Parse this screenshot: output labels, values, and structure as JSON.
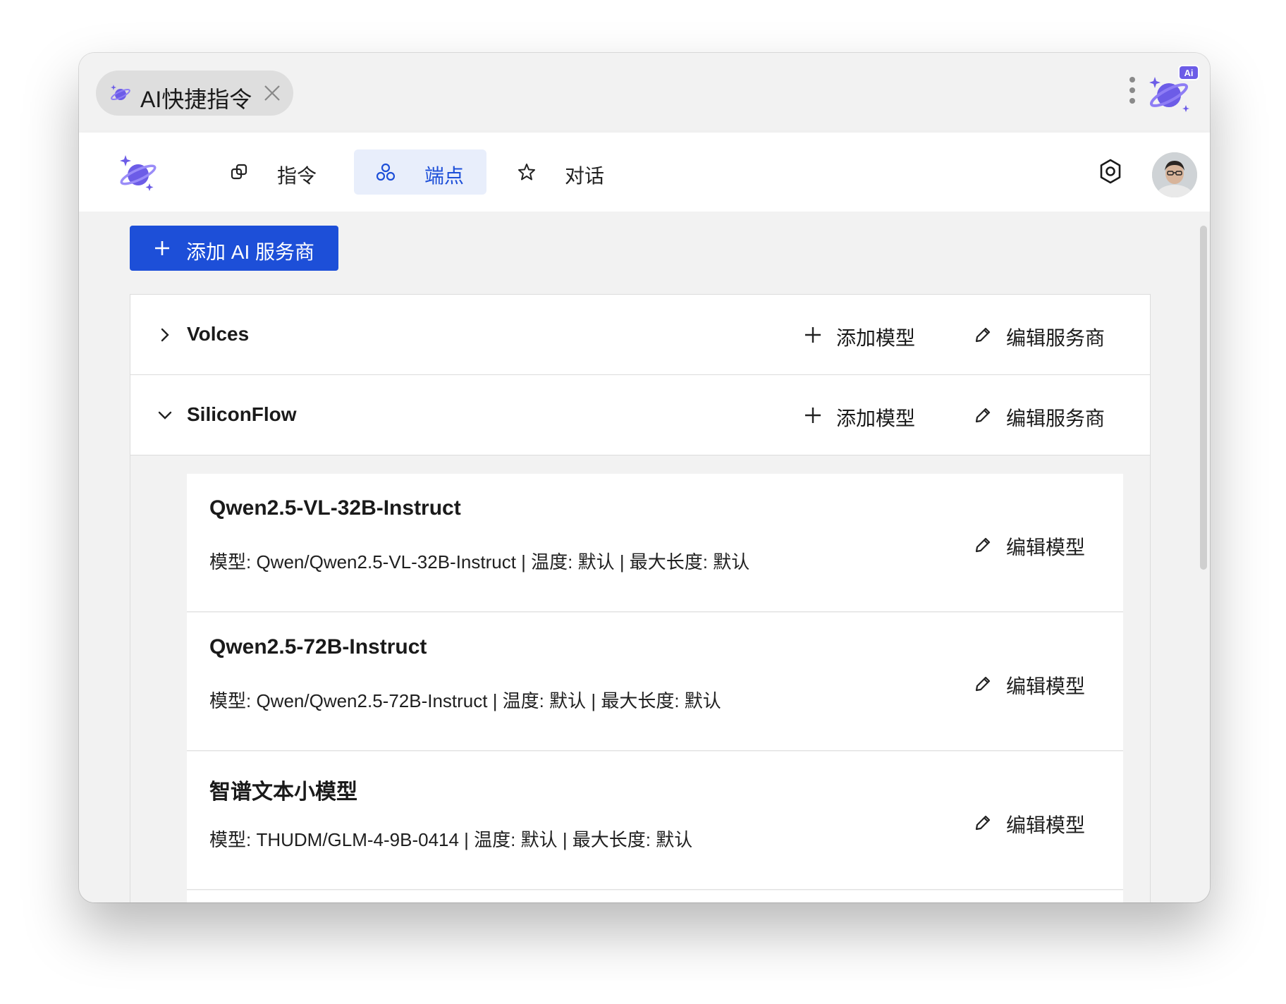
{
  "window": {
    "tab": {
      "title": "AI快捷指令",
      "logo_icon": "ai-planet-icon",
      "close_icon": "close-icon"
    },
    "menu_icon": "kebab-menu-icon",
    "corner_logo": {
      "icon": "ai-planet-icon",
      "badge": "Ai"
    }
  },
  "navbar": {
    "logo_icon": "planet-logo-icon",
    "items": [
      {
        "label": "指令",
        "icon": "command-icon",
        "active": false
      },
      {
        "label": "端点",
        "icon": "endpoints-icon",
        "active": true
      },
      {
        "label": "对话",
        "icon": "star-chat-icon",
        "active": false
      }
    ],
    "settings_icon": "settings-icon",
    "avatar": "user-avatar"
  },
  "toolbar": {
    "add_provider_label": "添加 AI 服务商"
  },
  "providers": [
    {
      "name": "Volces",
      "expanded": false,
      "add_model_label": "添加模型",
      "edit_provider_label": "编辑服务商"
    },
    {
      "name": "SiliconFlow",
      "expanded": true,
      "add_model_label": "添加模型",
      "edit_provider_label": "编辑服务商"
    }
  ],
  "models": [
    {
      "title": "Qwen2.5-VL-32B-Instruct",
      "description": "模型: Qwen/Qwen2.5-VL-32B-Instruct | 温度: 默认 | 最大长度: 默认",
      "edit_label": "编辑模型"
    },
    {
      "title": "Qwen2.5-72B-Instruct",
      "description": "模型: Qwen/Qwen2.5-72B-Instruct | 温度: 默认 | 最大长度: 默认",
      "edit_label": "编辑模型"
    },
    {
      "title": "智谱文本小模型",
      "description": "模型: THUDM/GLM-4-9B-0414 | 温度: 默认 | 最大长度: 默认",
      "edit_label": "编辑模型"
    }
  ],
  "colors": {
    "accent": "#1d4fd8",
    "active_nav_bg": "#e8eefb",
    "logo_purple": "#6c5ce7"
  }
}
